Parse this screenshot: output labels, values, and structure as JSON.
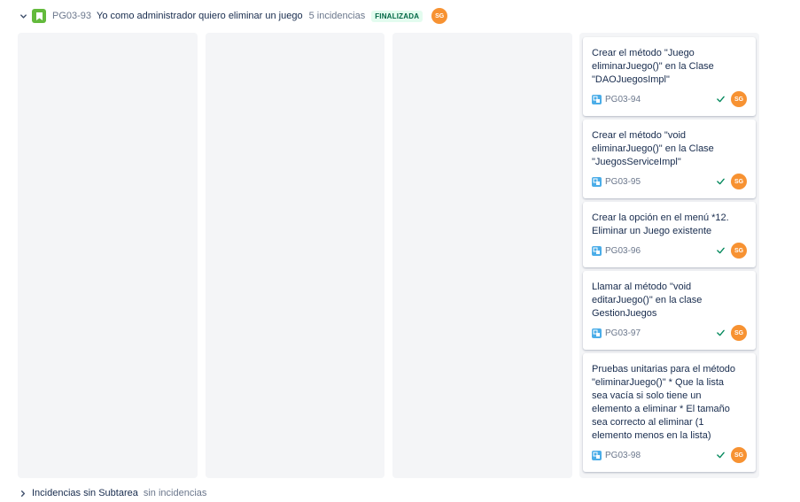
{
  "story": {
    "key": "PG03-93",
    "summary": "Yo como administrador quiero eliminar un juego",
    "count": "5 incidencias",
    "status": "FINALIZADA",
    "avatar": "SG"
  },
  "colors": {
    "story_icon": "#63ba3c",
    "subtask_icon": "#4bade8",
    "avatar": "#f79232",
    "done_check": "#00875a",
    "status_badge_bg": "#e3fcef",
    "status_badge_text": "#006644"
  },
  "cards": [
    {
      "title": "Crear el método \"Juego eliminarJuego()\" en la Clase \"DAOJuegosImpl\"",
      "key": "PG03-94",
      "avatar": "SG",
      "icon": "subtask-icon",
      "done": true
    },
    {
      "title": "Crear el método \"void eliminarJuego()\" en la Clase \"JuegosServiceImpl\"",
      "key": "PG03-95",
      "avatar": "SG",
      "icon": "subtask-icon",
      "done": true
    },
    {
      "title": "Crear la opción en el menú *12. Eliminar un Juego existente",
      "key": "PG03-96",
      "avatar": "SG",
      "icon": "subtask-icon",
      "done": true
    },
    {
      "title": "Llamar al método \"void editarJuego()\" en la clase GestionJuegos",
      "key": "PG03-97",
      "avatar": "SG",
      "icon": "subtask-icon",
      "done": true
    },
    {
      "title": "Pruebas unitarias para el método \"eliminarJuego()\" * Que la lista sea vacía si solo tiene un elemento a eliminar * El tamaño sea correcto al eliminar (1 elemento menos en la lista)",
      "key": "PG03-98",
      "avatar": "SG",
      "icon": "subtask-icon",
      "done": true
    }
  ],
  "footer": {
    "label": "Incidencias sin Subtarea",
    "count": "sin incidencias"
  }
}
